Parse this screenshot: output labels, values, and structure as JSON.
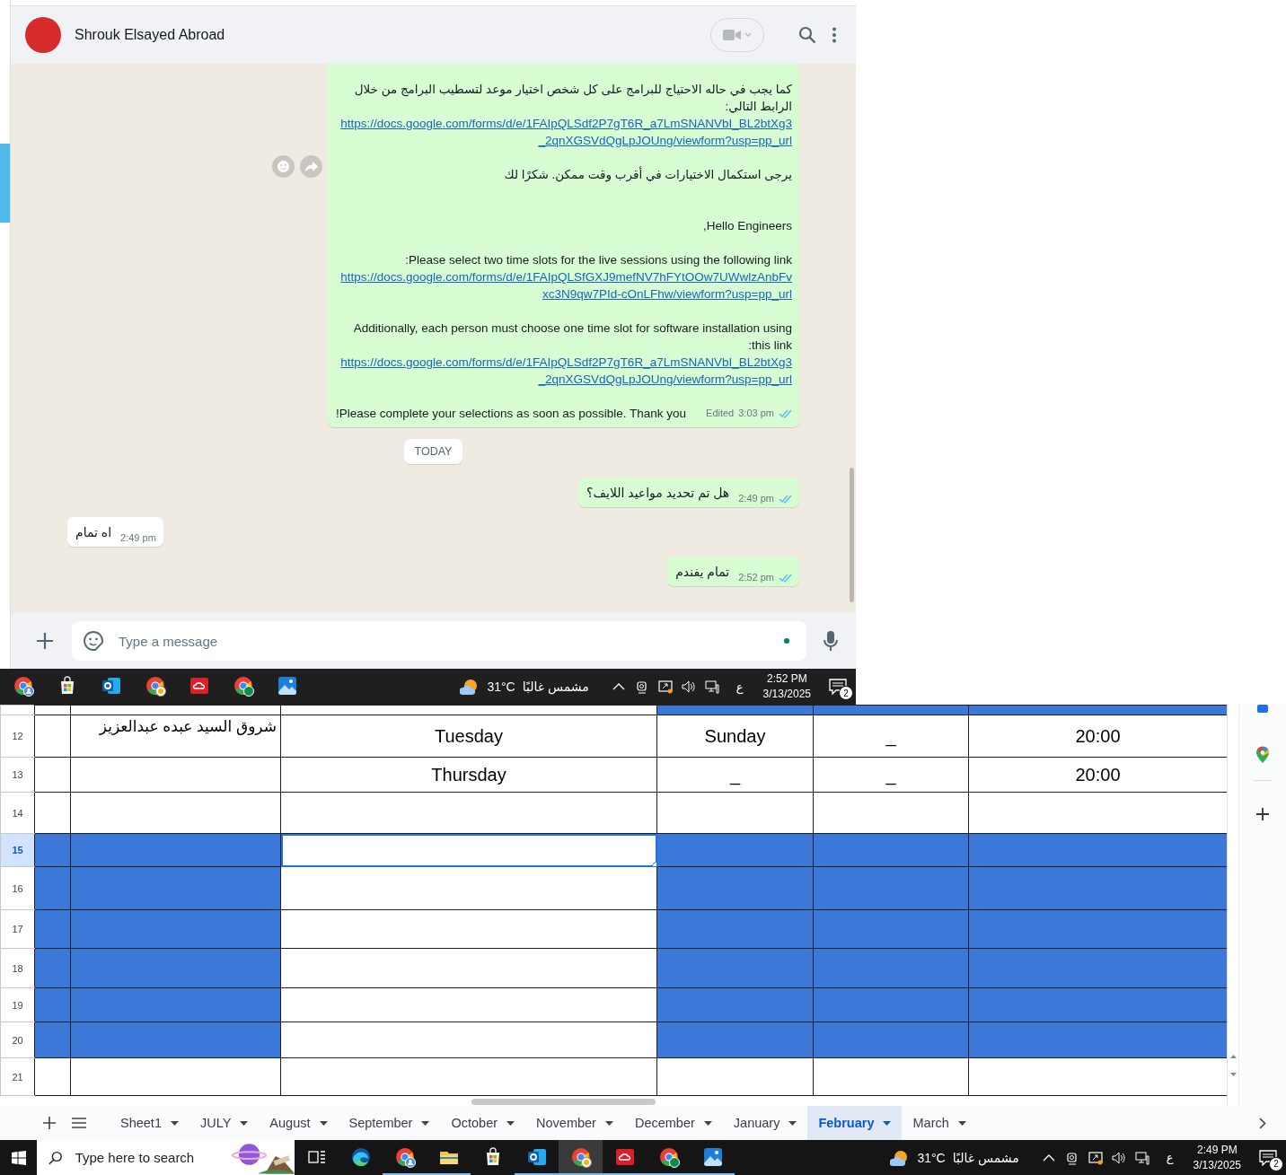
{
  "chat": {
    "contact": "Shrouk Elsayed Abroad",
    "messages": [
      {
        "kind": "outgoing",
        "paragraphs": [
          {
            "lines": [
              {
                "kind": "text",
                "text": "كما يجب في حاله الاحتياج للبرامج على كل شخص اختيار موعد لتسطيب  البرامج من خلال الرابط التالي:"
              },
              {
                "kind": "link",
                "text": "https://docs.google.com/forms/d/e/1FAIpQLSdf2P7gT6R_a7LmSNANVbI_BL2btXg3_2qnXGSVdQgLpJOUng/viewform?usp=pp_url"
              }
            ]
          },
          {
            "lines": [
              {
                "kind": "text",
                "text": "يرجى استكمال الاختيارات في أقرب وقت ممكن. شكرًا لك"
              }
            ]
          },
          {
            "lines": [
              {
                "kind": "text",
                "text": "Hello Engineers,"
              }
            ]
          },
          {
            "lines": [
              {
                "kind": "text",
                "text": "Please select two time slots for the live sessions using the following link:"
              },
              {
                "kind": "link",
                "text": "https://docs.google.com/forms/d/e/1FAIpQLSfGXJ9mefNV7hFYtOOw7UWwlzAnbFvxc3N9qw7PId-cOnLFhw/viewform?usp=pp_url"
              }
            ]
          },
          {
            "lines": [
              {
                "kind": "text",
                "text": "Additionally, each person must choose one time slot for software installation using this link:"
              },
              {
                "kind": "link",
                "text": "https://docs.google.com/forms/d/e/1FAIpQLSdf2P7gT6R_a7LmSNANVbI_BL2btXg3_2qnXGSVdQgLpJOUng/viewform?usp=pp_url"
              }
            ]
          },
          {
            "lines": [
              {
                "kind": "text",
                "text": "Please complete your selections as soon as possible. Thank you!"
              }
            ]
          }
        ],
        "edited": "Edited",
        "time": "3:03 pm",
        "read": true
      },
      {
        "kind": "date",
        "text": "TODAY"
      },
      {
        "kind": "outgoing",
        "text": "هل تم تحديد مواعيد اللايف؟",
        "time": "2:49 pm",
        "read": true
      },
      {
        "kind": "incoming",
        "text": "اه تمام",
        "time": "2:49 pm"
      },
      {
        "kind": "outgoing",
        "text": "تمام يفندم",
        "time": "2:52 pm",
        "read": true
      }
    ],
    "composer": {
      "placeholder": "Type a message"
    }
  },
  "taskbar_top": {
    "apps": [
      {
        "kind": "browser-profile"
      },
      {
        "kind": "store"
      },
      {
        "kind": "mail"
      },
      {
        "kind": "browser-badge"
      },
      {
        "kind": "cloud"
      },
      {
        "kind": "browser-w"
      },
      {
        "kind": "photos"
      }
    ],
    "weather": {
      "temperature": "31°C",
      "condition": "مشمس غالبًا"
    },
    "language": "ع",
    "time": "2:52 PM",
    "date": "3/13/2025",
    "notifications": "2"
  },
  "sheet": {
    "rows": [
      {
        "cells": [
          {
            "filled": false,
            "selected": false
          },
          {
            "filled": false,
            "selected": false
          },
          {
            "filled": false,
            "selected": false
          },
          {
            "filled": true,
            "selected": false
          },
          {
            "filled": true,
            "selected": false
          },
          {
            "filled": true,
            "selected": false
          }
        ]
      },
      {
        "number": "12",
        "cells": [
          {
            "filled": false,
            "selected": false
          },
          {
            "text": "شروق السيد عبده عبدالعزيز",
            "filled": false,
            "selected": false
          },
          {
            "text": "Tuesday",
            "filled": false,
            "selected": false
          },
          {
            "text": "Sunday",
            "filled": false,
            "selected": false
          },
          {
            "text": "_",
            "filled": false,
            "selected": false
          },
          {
            "text": "20:00",
            "filled": false,
            "selected": false
          }
        ]
      },
      {
        "number": "13",
        "cells": [
          {
            "filled": false,
            "selected": false
          },
          {
            "filled": false,
            "selected": false
          },
          {
            "text": "Thursday",
            "filled": false,
            "selected": false
          },
          {
            "text": "_",
            "filled": false,
            "selected": false
          },
          {
            "text": "_",
            "filled": false,
            "selected": false
          },
          {
            "text": "20:00",
            "filled": false,
            "selected": false
          }
        ]
      },
      {
        "number": "14",
        "cells": [
          {
            "filled": false,
            "selected": false
          },
          {
            "filled": false,
            "selected": false
          },
          {
            "filled": false,
            "selected": false
          },
          {
            "filled": false,
            "selected": false
          },
          {
            "filled": false,
            "selected": false
          },
          {
            "filled": false,
            "selected": false
          }
        ]
      },
      {
        "number": "15",
        "cells": [
          {
            "filled": true,
            "selected": false
          },
          {
            "filled": true,
            "selected": false
          },
          {
            "filled": false,
            "selected": true
          },
          {
            "filled": true,
            "selected": false
          },
          {
            "filled": true,
            "selected": false
          },
          {
            "filled": true,
            "selected": false
          }
        ]
      },
      {
        "number": "16",
        "cells": [
          {
            "filled": true,
            "selected": false
          },
          {
            "filled": true,
            "selected": false
          },
          {
            "filled": false,
            "selected": false
          },
          {
            "filled": true,
            "selected": false
          },
          {
            "filled": true,
            "selected": false
          },
          {
            "filled": true,
            "selected": false
          }
        ]
      },
      {
        "number": "17",
        "cells": [
          {
            "filled": true,
            "selected": false
          },
          {
            "filled": true,
            "selected": false
          },
          {
            "filled": false,
            "selected": false
          },
          {
            "filled": true,
            "selected": false
          },
          {
            "filled": true,
            "selected": false
          },
          {
            "filled": true,
            "selected": false
          }
        ]
      },
      {
        "number": "18",
        "cells": [
          {
            "filled": true,
            "selected": false
          },
          {
            "filled": true,
            "selected": false
          },
          {
            "filled": false,
            "selected": false
          },
          {
            "filled": true,
            "selected": false
          },
          {
            "filled": true,
            "selected": false
          },
          {
            "filled": true,
            "selected": false
          }
        ]
      },
      {
        "number": "19",
        "cells": [
          {
            "filled": true,
            "selected": false
          },
          {
            "filled": true,
            "selected": false
          },
          {
            "filled": false,
            "selected": false
          },
          {
            "filled": true,
            "selected": false
          },
          {
            "filled": true,
            "selected": false
          },
          {
            "filled": true,
            "selected": false
          }
        ]
      },
      {
        "number": "20",
        "cells": [
          {
            "filled": true,
            "selected": false
          },
          {
            "filled": true,
            "selected": false
          },
          {
            "filled": false,
            "selected": false
          },
          {
            "filled": true,
            "selected": false
          },
          {
            "filled": true,
            "selected": false
          },
          {
            "filled": true,
            "selected": false
          }
        ]
      },
      {
        "number": "21",
        "cells": [
          {
            "filled": false,
            "selected": false
          },
          {
            "filled": false,
            "selected": false
          },
          {
            "filled": false,
            "selected": false
          },
          {
            "filled": false,
            "selected": false
          },
          {
            "filled": false,
            "selected": false
          },
          {
            "filled": false,
            "selected": false
          }
        ]
      }
    ]
  },
  "sheet_tabs": [
    {
      "label": "Sheet1",
      "selected": false
    },
    {
      "label": "JULY",
      "selected": false
    },
    {
      "label": "August",
      "selected": false
    },
    {
      "label": "September",
      "selected": false
    },
    {
      "label": "October",
      "selected": false
    },
    {
      "label": "November",
      "selected": false
    },
    {
      "label": "December",
      "selected": false
    },
    {
      "label": "January",
      "selected": false
    },
    {
      "label": "February",
      "selected": true
    },
    {
      "label": "March",
      "selected": false
    }
  ],
  "taskbar_bottom": {
    "search": {
      "placeholder": "Type here to search"
    },
    "apps": [
      {
        "kind": "task-view",
        "running": false,
        "selected": false
      },
      {
        "kind": "edge",
        "running": false,
        "selected": false
      },
      {
        "kind": "browser-profile",
        "running": true,
        "selected": false
      },
      {
        "kind": "folder",
        "running": true,
        "selected": false
      },
      {
        "kind": "store",
        "running": false,
        "selected": false
      },
      {
        "kind": "mail",
        "running": true,
        "selected": false
      },
      {
        "kind": "browser-badge",
        "running": true,
        "selected": true
      },
      {
        "kind": "cloud",
        "running": true,
        "selected": false
      },
      {
        "kind": "browser-w",
        "running": true,
        "selected": false
      },
      {
        "kind": "photos",
        "running": true,
        "selected": false
      }
    ],
    "weather": {
      "temperature": "31°C",
      "condition": "مشمس غالبًا"
    },
    "language": "ع",
    "time": "2:49 PM",
    "date": "3/13/2025",
    "notifications": "2"
  }
}
